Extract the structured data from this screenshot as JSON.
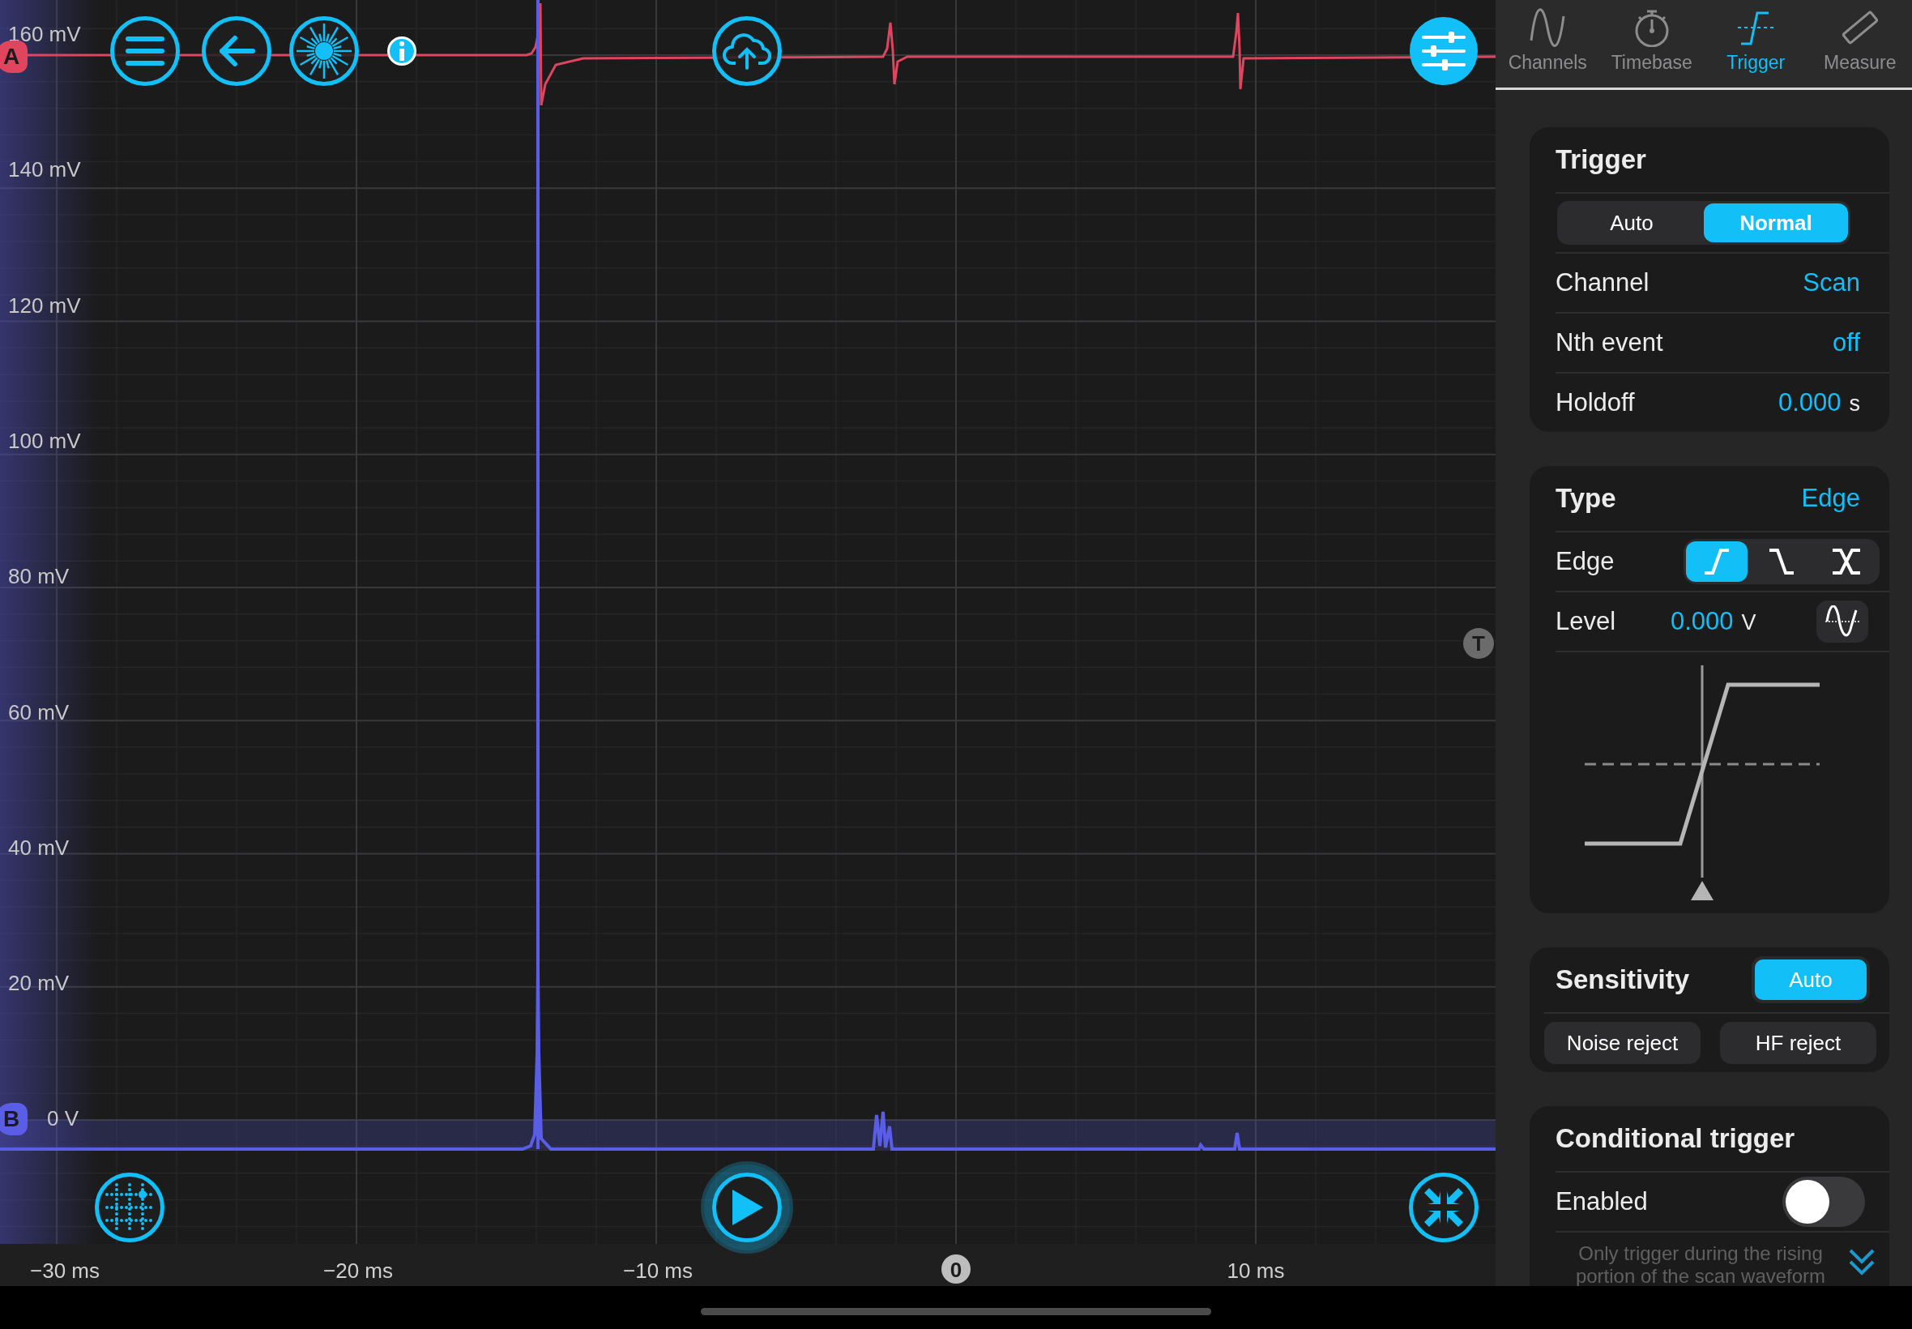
{
  "scope": {
    "channel_markers": [
      {
        "label": "A",
        "color": "#e0455f"
      },
      {
        "label": "B",
        "color": "#5a5de6"
      }
    ],
    "y_axis_labels": [
      "160 mV",
      "140 mV",
      "120 mV",
      "100 mV",
      "80 mV",
      "60 mV",
      "40 mV",
      "20 mV",
      "0 V"
    ],
    "x_axis_labels": [
      "−30 ms",
      "−20 ms",
      "−10 ms",
      "10 ms"
    ],
    "zero_marker": "0",
    "trigger_marker": "T"
  },
  "top_buttons": [
    {
      "kind": "menu",
      "filled": false
    },
    {
      "kind": "back",
      "filled": false
    },
    {
      "kind": "burst",
      "filled": false
    },
    {
      "kind": "info",
      "filled": true
    },
    {
      "kind": "upload",
      "filled": false
    },
    {
      "kind": "sliders",
      "filled": true
    }
  ],
  "bottom_buttons": [
    {
      "kind": "grid",
      "filled": false
    },
    {
      "kind": "play",
      "filled": false
    },
    {
      "kind": "collapse",
      "filled": false
    }
  ],
  "panel": {
    "tabs": [
      {
        "label": "Channels",
        "kind": "wave",
        "selected": false
      },
      {
        "label": "Timebase",
        "kind": "stopwatch",
        "selected": false
      },
      {
        "label": "Trigger",
        "kind": "trigger",
        "selected": true
      },
      {
        "label": "Measure",
        "kind": "ruler",
        "selected": false
      }
    ],
    "trigger": {
      "title": "Trigger",
      "modes": [
        {
          "label": "Auto",
          "selected": false
        },
        {
          "label": "Normal",
          "selected": true
        }
      ],
      "rows": [
        {
          "label": "Channel",
          "value": "Scan"
        },
        {
          "label": "Nth event",
          "value": "off"
        },
        {
          "label": "Holdoff",
          "value": "0.000",
          "unit": "s"
        }
      ]
    },
    "type": {
      "title": "Type",
      "value": "Edge",
      "edge_label": "Edge",
      "edges": [
        {
          "kind": "rising",
          "selected": true
        },
        {
          "kind": "falling",
          "selected": false
        },
        {
          "kind": "either",
          "selected": false
        }
      ],
      "level_label": "Level",
      "level_value": "0.000",
      "level_unit": "V"
    },
    "sensitivity": {
      "title": "Sensitivity",
      "auto": {
        "label": "Auto",
        "selected": true
      },
      "filters": [
        {
          "label": "Noise reject",
          "selected": false
        },
        {
          "label": "HF reject",
          "selected": false
        }
      ]
    },
    "conditional": {
      "title": "Conditional trigger",
      "enabled_label": "Enabled",
      "enabled": false,
      "note": "Only trigger during the rising portion of the scan waveform"
    }
  }
}
